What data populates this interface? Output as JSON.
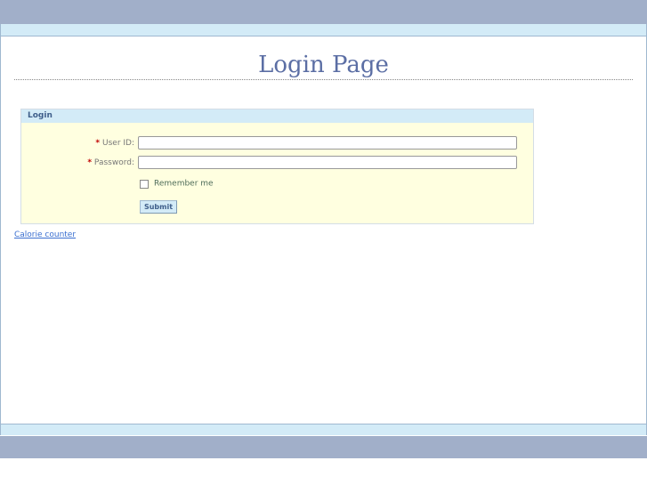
{
  "page": {
    "title": "Login Page"
  },
  "login_panel": {
    "header": "Login",
    "user_id": {
      "label": "User ID:",
      "value": "",
      "placeholder": ""
    },
    "password": {
      "label": "Password:",
      "value": "",
      "placeholder": ""
    },
    "remember_label": "Remember me",
    "remember_checked": false,
    "submit_label": "Submit",
    "required_marker": "*"
  },
  "links": {
    "calorie_counter": "Calorie counter"
  }
}
